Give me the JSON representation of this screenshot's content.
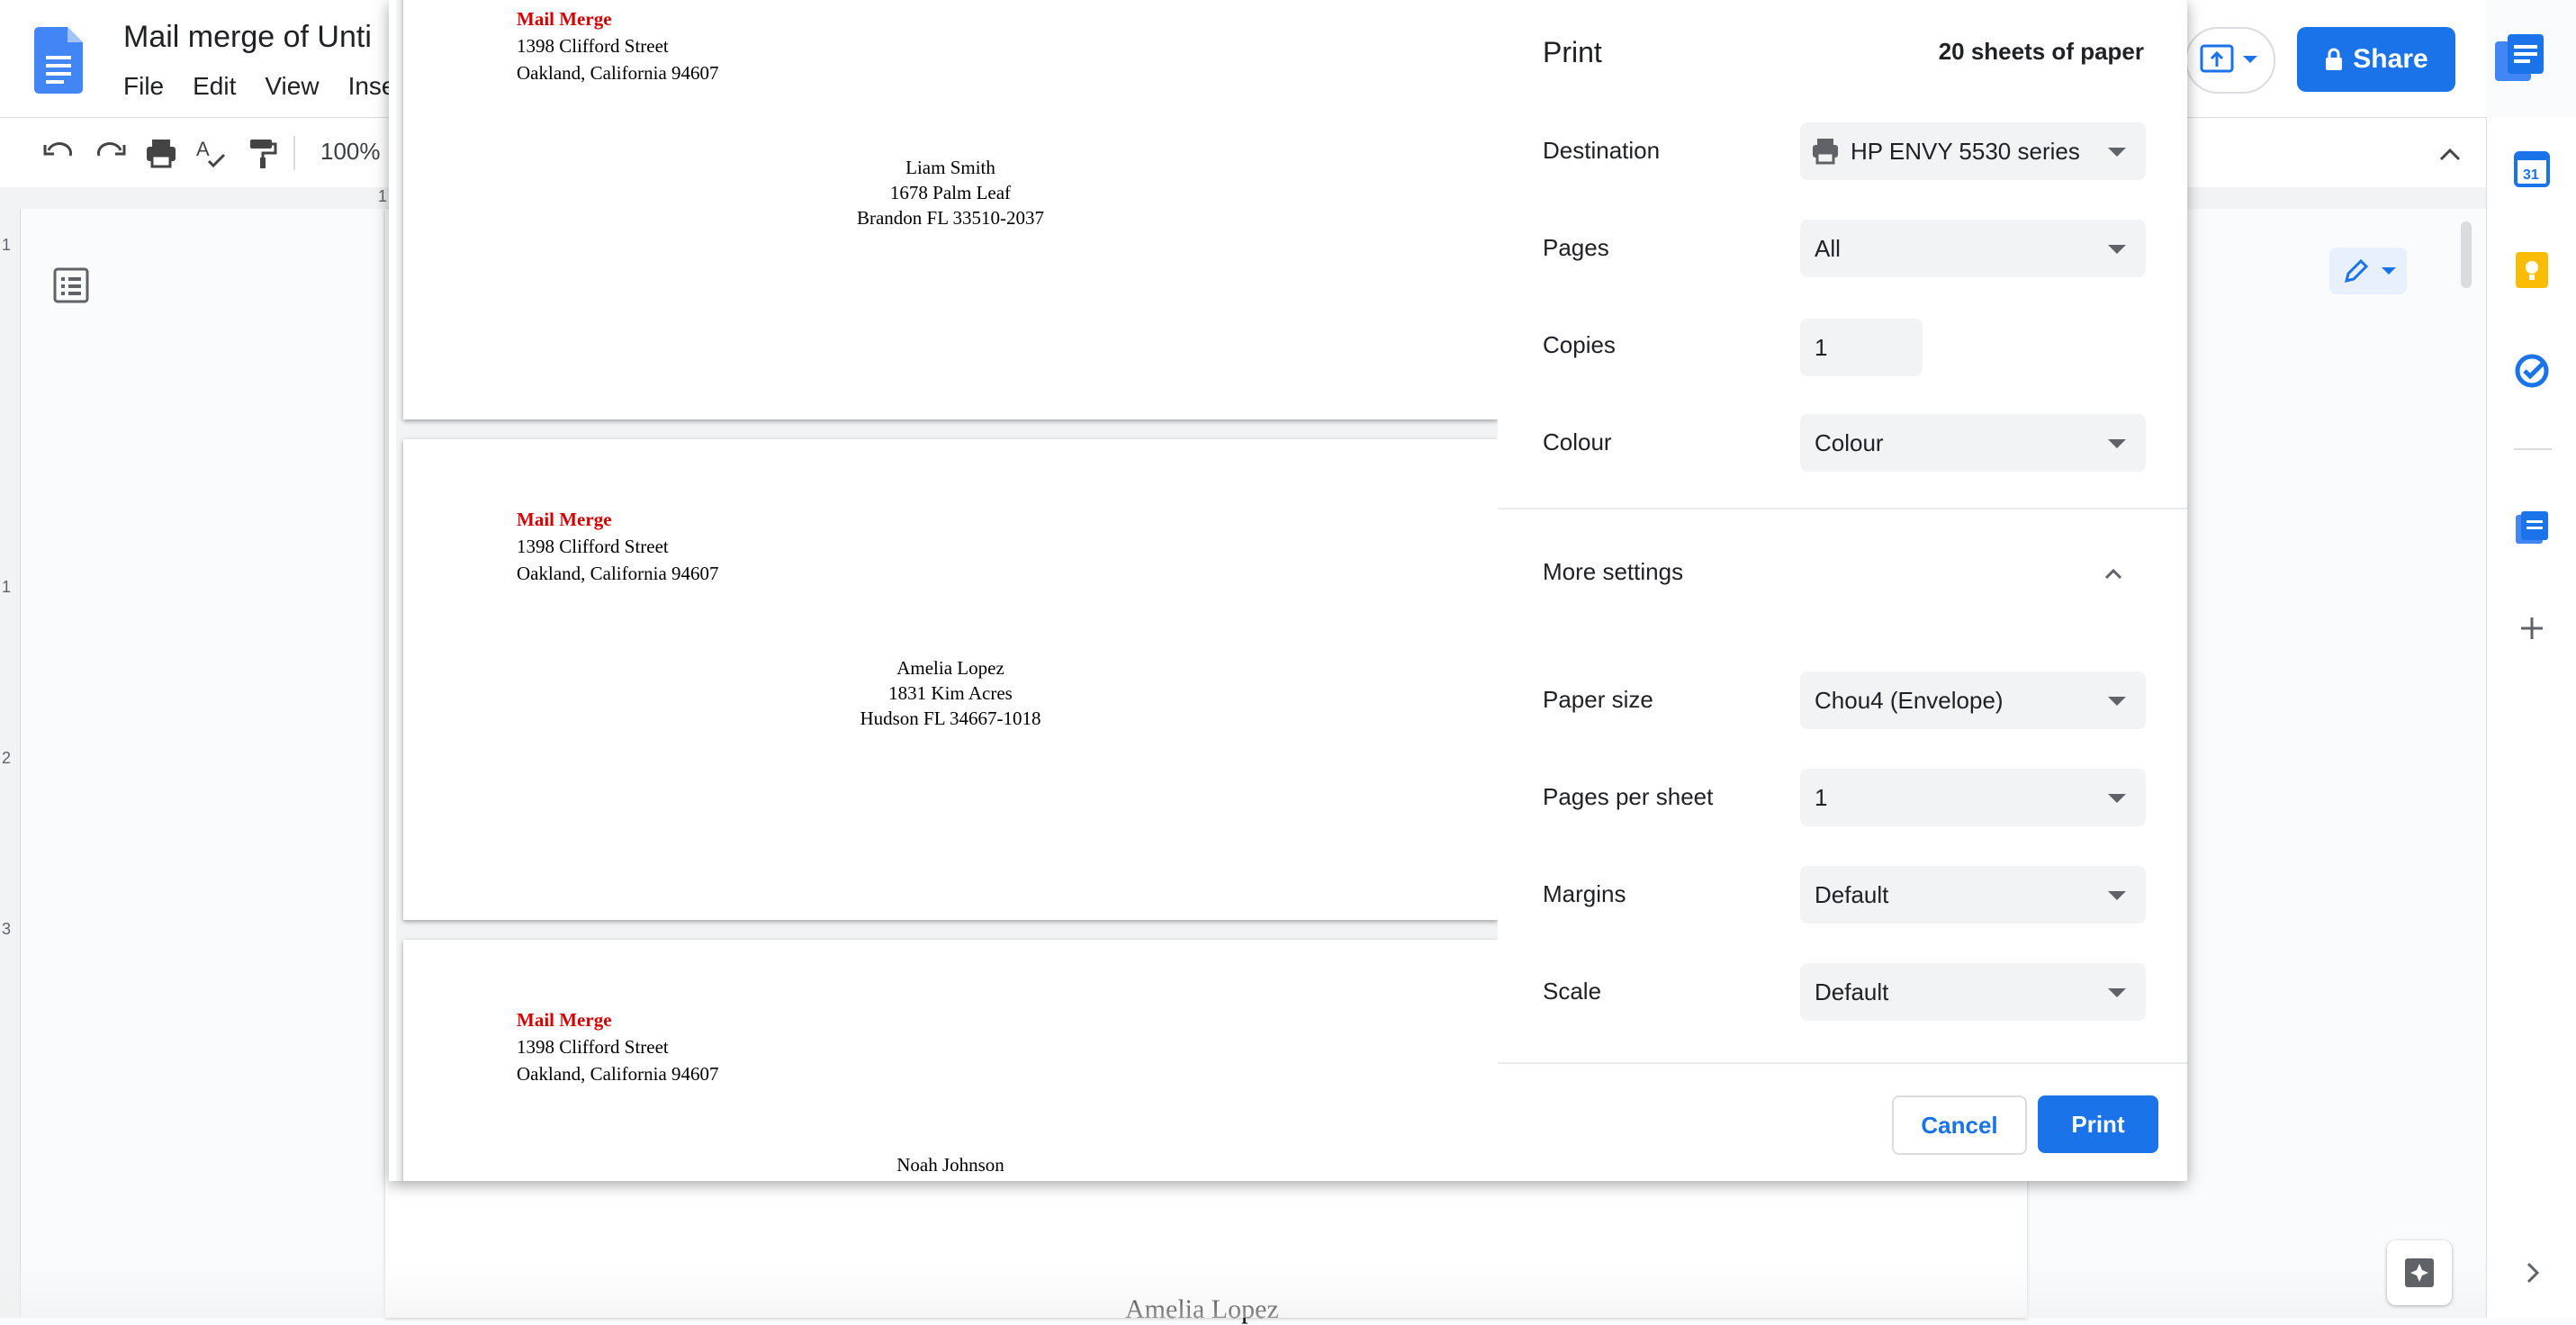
{
  "app": {
    "doc_title": "Mail merge of Unti",
    "menu": [
      "File",
      "Edit",
      "View",
      "Inse"
    ],
    "zoom": "100%",
    "share_label": "Share",
    "ruler_numbers": [
      "1",
      "1",
      "2",
      "3"
    ],
    "ruler_top_number": "1",
    "doc_body_text": "Amelia Lopez",
    "colors": {
      "brand": "#1a73e8",
      "return_company": "#d40000"
    }
  },
  "print": {
    "title": "Print",
    "sheets": "20 sheets of paper",
    "settings": {
      "destination": {
        "label": "Destination",
        "value": "HP ENVY 5530 series"
      },
      "pages": {
        "label": "Pages",
        "value": "All"
      },
      "copies": {
        "label": "Copies",
        "value": "1"
      },
      "colour": {
        "label": "Colour",
        "value": "Colour"
      },
      "more_settings": "More settings",
      "paper_size": {
        "label": "Paper size",
        "value": "Chou4 (Envelope)"
      },
      "pages_per_sheet": {
        "label": "Pages per sheet",
        "value": "1"
      },
      "margins": {
        "label": "Margins",
        "value": "Default"
      },
      "scale": {
        "label": "Scale",
        "value": "Default"
      }
    },
    "cancel_label": "Cancel",
    "print_label": "Print",
    "preview": {
      "return_address": {
        "company": "Mail Merge",
        "street": "1398 Clifford Street",
        "city": "Oakland, California 94607"
      },
      "envelopes": [
        {
          "name": "Liam Smith",
          "street": "1678 Palm Leaf",
          "city": "Brandon FL 33510-2037"
        },
        {
          "name": "Amelia Lopez",
          "street": "1831 Kim Acres",
          "city": "Hudson FL 34667-1018"
        },
        {
          "name": "Noah Johnson"
        }
      ]
    }
  }
}
